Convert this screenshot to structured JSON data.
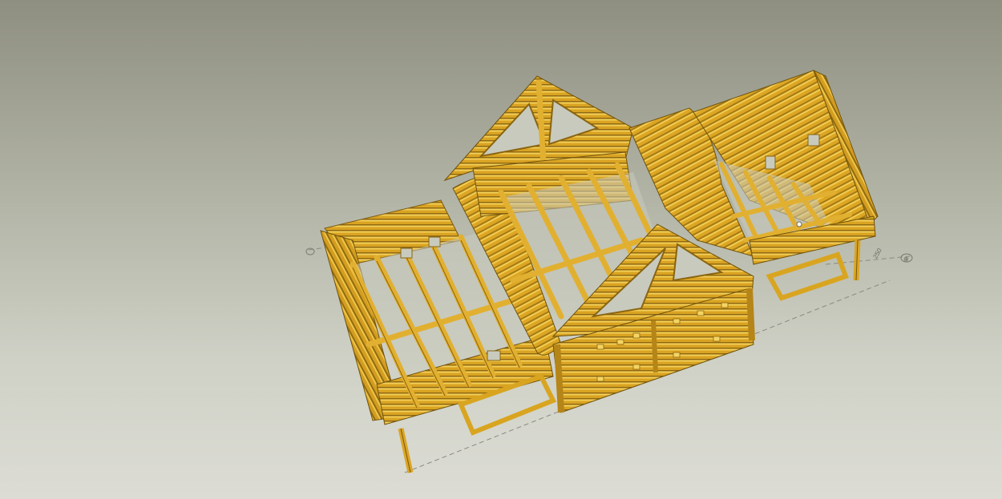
{
  "viewport": {
    "background_top": "#8e8f80",
    "background_bottom": "#dcdcd4",
    "wood_color": "#d9a520",
    "wood_dark": "#8a6410",
    "wood_light": "#f0c848"
  },
  "annotations": {
    "dimension_text": "250",
    "axis_marker": "⊕"
  }
}
